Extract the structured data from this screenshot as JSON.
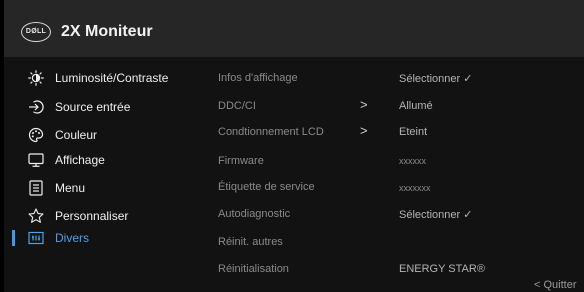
{
  "header": {
    "logo_text": "DØLL",
    "title": "2X Moniteur"
  },
  "sidebar": {
    "items": [
      {
        "label": "Luminosité/Contraste",
        "icon": "brightness-icon"
      },
      {
        "label": "Source entrée",
        "icon": "input-source-icon"
      },
      {
        "label": "Couleur",
        "icon": "color-palette-icon"
      },
      {
        "label": "Affichage",
        "icon": "display-monitor-icon"
      },
      {
        "label": "Menu",
        "icon": "menu-list-icon"
      },
      {
        "label": "Personnaliser",
        "icon": "star-icon"
      },
      {
        "label": "Divers",
        "icon": "others-icon",
        "active": true
      }
    ]
  },
  "main": {
    "rows": [
      {
        "label": "Infos d'affichage",
        "arrow": "",
        "value": "Sélectionner ✓"
      },
      {
        "label": "DDC/CI",
        "arrow": ">",
        "value": "Allumé"
      },
      {
        "label": "Condtionnement LCD",
        "arrow": ">",
        "value": "Eteint"
      },
      {
        "label": "Firmware",
        "arrow": "",
        "value": "xxxxxx"
      },
      {
        "label": "Étiquette de service",
        "arrow": "",
        "value": "xxxxxxx"
      },
      {
        "label": "Autodiagnostic",
        "arrow": "",
        "value": "Sélectionner ✓"
      },
      {
        "label": "Réinit. autres",
        "arrow": "",
        "value": ""
      },
      {
        "label": "Réinitialisation",
        "arrow": "",
        "value": "ENERGY STAR®"
      }
    ]
  },
  "footer": {
    "exit_label": "< Quitter"
  },
  "colors": {
    "accent": "#3d9be9",
    "background": "#121212",
    "header": "#262626"
  }
}
